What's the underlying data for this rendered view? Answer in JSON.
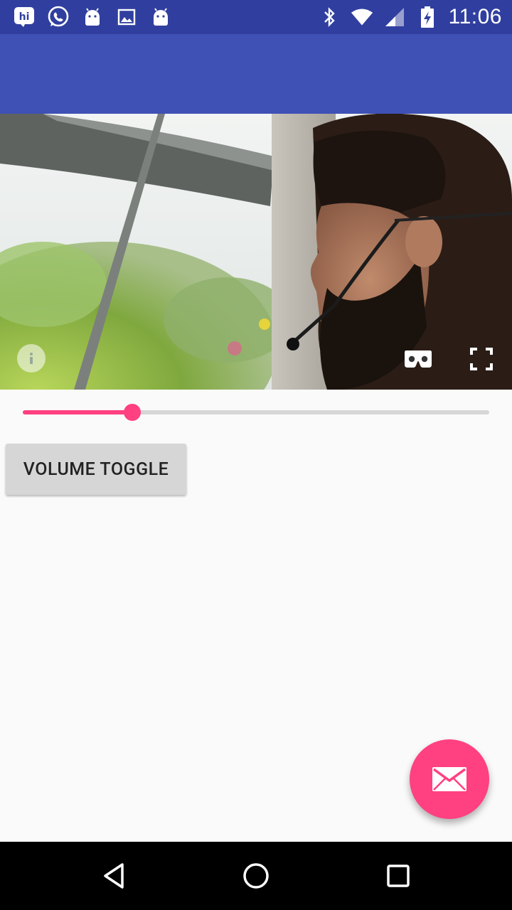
{
  "status_bar": {
    "time": "11:06",
    "left_icons": [
      "hike-icon",
      "whatsapp-icon",
      "android-icon",
      "image-icon",
      "android-icon"
    ],
    "right_icons": [
      "bluetooth-icon",
      "wifi-icon",
      "signal-icon",
      "battery-charging-icon"
    ]
  },
  "app_bar": {
    "title": ""
  },
  "video": {
    "controls": [
      "info-icon",
      "cardboard-vr-icon",
      "fullscreen-icon"
    ]
  },
  "seekbar": {
    "progress_fraction": 0.235
  },
  "main": {
    "volume_toggle_label": "VOLUME TOGGLE"
  },
  "fab": {
    "icon": "mail-icon"
  },
  "nav_bar": {
    "buttons": [
      "back-icon",
      "home-icon",
      "recents-icon"
    ]
  },
  "colors": {
    "status_bar": "#303f9f",
    "app_bar": "#3f51b5",
    "accent": "#ff4081",
    "background": "#fafafa"
  }
}
